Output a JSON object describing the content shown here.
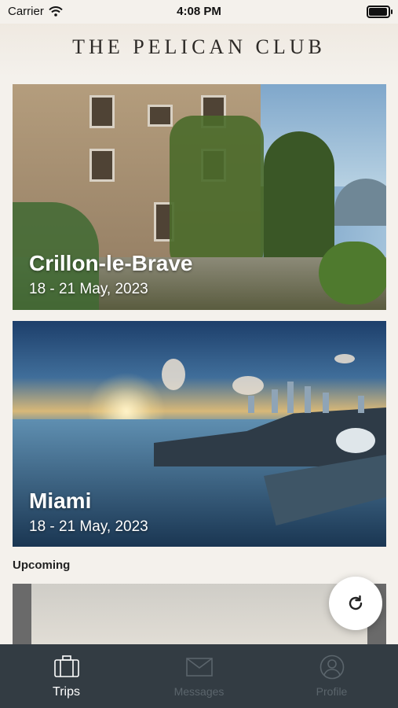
{
  "status_bar": {
    "carrier": "Carrier",
    "time": "4:08 PM",
    "battery_level": 0.9
  },
  "header": {
    "title": "THE PELICAN CLUB"
  },
  "trips": [
    {
      "name": "Crillon-le-Brave",
      "dates": "18 - 21 May, 2023"
    },
    {
      "name": "Miami",
      "dates": "18 - 21 May, 2023"
    }
  ],
  "upcoming": {
    "section_label": "Upcoming"
  },
  "tabs": [
    {
      "label": "Trips",
      "icon": "suitcase-icon",
      "active": true
    },
    {
      "label": "Messages",
      "icon": "envelope-icon",
      "active": false
    },
    {
      "label": "Profile",
      "icon": "person-icon",
      "active": false
    }
  ],
  "colors": {
    "background": "#f4f1ec",
    "tab_bar": "#333c43",
    "tab_active": "#ffffff",
    "tab_inactive": "#5b656c"
  }
}
